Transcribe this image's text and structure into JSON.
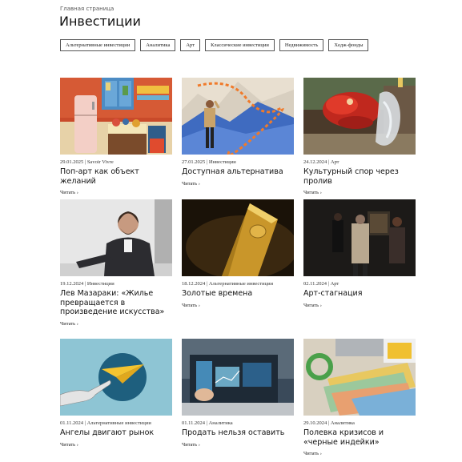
{
  "breadcrumb": "Главная страница",
  "page_title": "Инвестиции",
  "filters": [
    "Альтернативные инвестиции",
    "Аналитика",
    "Арт",
    "Классические инвестиции",
    "Недвижимость",
    "Хедж-фонды"
  ],
  "read_more": "Читать ›",
  "articles": [
    {
      "date": "29.01.2025",
      "category": "Savoir Vivre",
      "title": "Поп-арт как объект желаний",
      "image": "pop-art-kitchen-image"
    },
    {
      "date": "27.01.2025",
      "category": "Инвестиции",
      "title": "Доступная альтернатива",
      "image": "man-on-path-collage-image"
    },
    {
      "date": "24.12.2024",
      "category": "Арт",
      "title": "Культурный спор через пролив",
      "image": "glass-dragon-sculpture-image"
    },
    {
      "date": "19.12.2024",
      "category": "Инвестиции",
      "title": "Лев Мазараки: «Жилье превращается в произведение искусства»",
      "image": "businessman-portrait-image"
    },
    {
      "date": "18.12.2024",
      "category": "Альтернативные инвестиции",
      "title": "Золотые времена",
      "image": "gold-bar-image"
    },
    {
      "date": "02.11.2024",
      "category": "Арт",
      "title": "Арт-стагнация",
      "image": "gallery-visitors-image"
    },
    {
      "date": "01.11.2024",
      "category": "Альтернативные инвестиции",
      "title": "Ангелы двигают рынок",
      "image": "hand-paper-plane-image"
    },
    {
      "date": "01.11.2024",
      "category": "Аналитика",
      "title": "Продать нельзя оставить",
      "image": "laptop-charts-image"
    },
    {
      "date": "29.10.2024",
      "category": "Аналитика",
      "title": "Полевка кризисов и «черные индейки»",
      "image": "euro-banknotes-image"
    }
  ],
  "colors": {
    "text": "#111111",
    "chip_border": "#555555",
    "background": "#ffffff"
  }
}
